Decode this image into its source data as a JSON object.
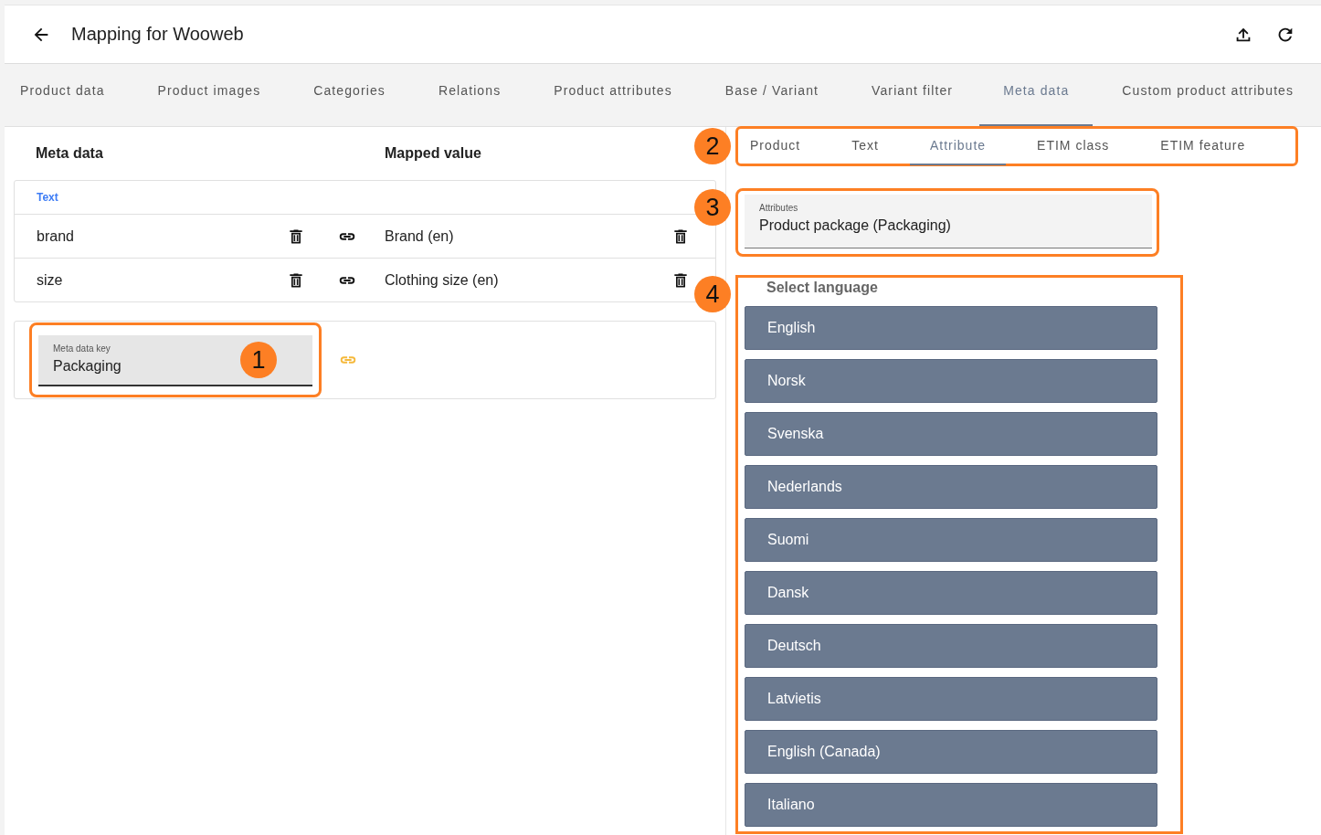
{
  "header": {
    "title": "Mapping for Wooweb"
  },
  "tabs": [
    {
      "label": "Product data",
      "selected": false
    },
    {
      "label": "Product images",
      "selected": false
    },
    {
      "label": "Categories",
      "selected": false
    },
    {
      "label": "Relations",
      "selected": false
    },
    {
      "label": "Product attributes",
      "selected": false
    },
    {
      "label": "Base / Variant",
      "selected": false
    },
    {
      "label": "Variant filter",
      "selected": false
    },
    {
      "label": "Meta data",
      "selected": true
    },
    {
      "label": "Custom product attributes",
      "selected": false
    }
  ],
  "table": {
    "columns": [
      "Meta data",
      "Mapped value"
    ],
    "group": "Text",
    "rows": [
      {
        "key": "brand",
        "value": "Brand (en)"
      },
      {
        "key": "size",
        "value": "Clothing size (en)"
      }
    ]
  },
  "new_key": {
    "label": "Meta data key",
    "value": "Packaging",
    "callout": "1"
  },
  "source_tabs": {
    "callout": "2",
    "items": [
      {
        "label": "Product",
        "selected": false
      },
      {
        "label": "Text",
        "selected": false
      },
      {
        "label": "Attribute",
        "selected": true
      },
      {
        "label": "ETIM class",
        "selected": false
      },
      {
        "label": "ETIM feature",
        "selected": false
      }
    ]
  },
  "attribute_field": {
    "label": "Attributes",
    "value": "Product package (Packaging)",
    "callout": "3"
  },
  "languages": {
    "callout": "4",
    "title": "Select language",
    "items": [
      "English",
      "Norsk",
      "Svenska",
      "Nederlands",
      "Suomi",
      "Dansk",
      "Deutsch",
      "Latvietis",
      "English (Canada)",
      "Italiano"
    ]
  }
}
